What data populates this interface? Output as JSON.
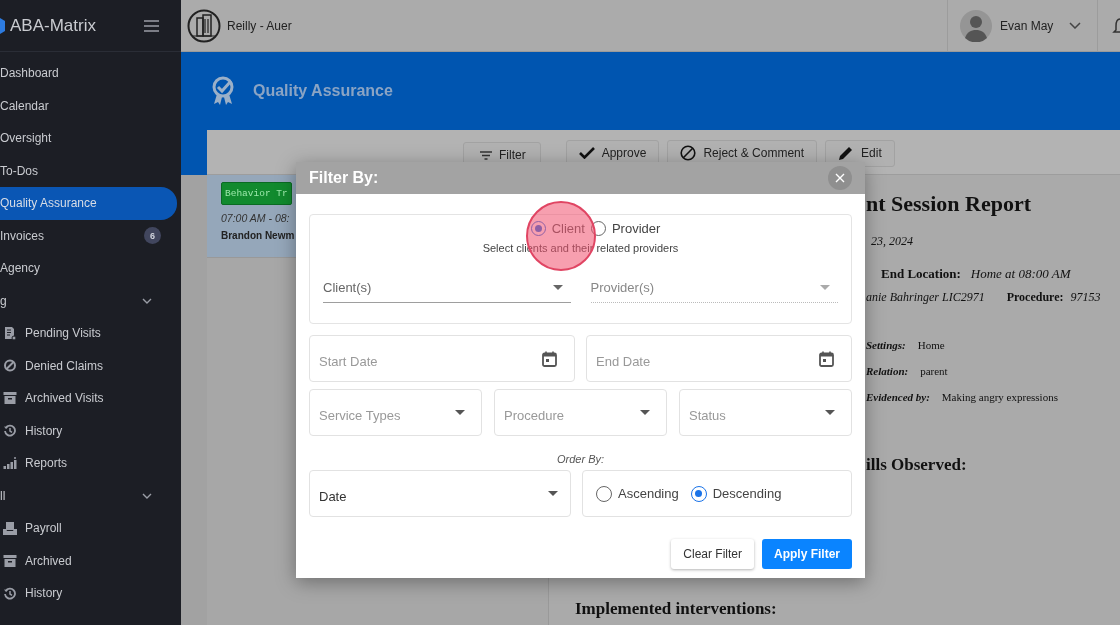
{
  "sidebar": {
    "brand": "ABA-Matrix",
    "items": [
      {
        "label": "Dashboard",
        "selected": false
      },
      {
        "label": "Calendar",
        "selected": false
      },
      {
        "label": "Oversight",
        "selected": false
      },
      {
        "label": "To-Dos",
        "selected": false
      },
      {
        "label": "Quality Assurance",
        "selected": true
      },
      {
        "label": "Invoices",
        "selected": false,
        "badge": "6"
      },
      {
        "label": "Agency",
        "selected": false
      }
    ],
    "sections": [
      {
        "title": "g",
        "expanded": true,
        "items": [
          {
            "label": "Pending Visits"
          },
          {
            "label": "Denied Claims"
          },
          {
            "label": "Archived Visits"
          },
          {
            "label": "History"
          },
          {
            "label": "Reports"
          }
        ]
      },
      {
        "title": "ll",
        "expanded": true,
        "items": [
          {
            "label": "Payroll"
          },
          {
            "label": "Archived"
          },
          {
            "label": "History"
          }
        ]
      }
    ]
  },
  "topbar": {
    "organization": "Reilly - Auer",
    "user": "Evan May"
  },
  "page_header": {
    "title": "Quality Assurance"
  },
  "toolbar": {
    "buttons": [
      "Filter",
      "Approve",
      "Reject & Comment",
      "Edit"
    ]
  },
  "visits": [
    {
      "tag": "Behavior Tr",
      "time": "07:00 AM - 08:",
      "client": "Brandon Newm",
      "selected": true
    }
  ],
  "report": {
    "title": "nt Session Report",
    "date": "23, 2024",
    "end_location_label": "End Location:",
    "end_location": "Home at 08:00 AM",
    "provider": "anie Bahringer LIC2971",
    "procedure_label": "Procedure:",
    "procedure": "97153",
    "details": [
      {
        "label": "Settings:",
        "value": "Home"
      },
      {
        "label": "Relation:",
        "value": "parent"
      },
      {
        "label": "Evidenced by:",
        "value": "Making angry expressions"
      }
    ],
    "skills_heading": "ills Observed:",
    "interventions_heading": "Implemented interventions:"
  },
  "modal": {
    "title": "Filter By:",
    "target_radios": [
      {
        "label": "Client",
        "selected": true
      },
      {
        "label": "Provider",
        "selected": false
      }
    ],
    "hint": "Select clients and their related providers",
    "client_select": {
      "placeholder": "Client(s)",
      "disabled": false
    },
    "provider_select": {
      "placeholder": "Provider(s)",
      "disabled": true
    },
    "start_date": {
      "placeholder": "Start Date"
    },
    "end_date": {
      "placeholder": "End Date"
    },
    "selects": [
      {
        "placeholder": "Service Types"
      },
      {
        "placeholder": "Procedure"
      },
      {
        "placeholder": "Status"
      }
    ],
    "order_by_label": "Order By:",
    "order_field": {
      "value": "Date"
    },
    "order_radios": [
      {
        "label": "Ascending",
        "selected": false
      },
      {
        "label": "Descending",
        "selected": true
      }
    ],
    "buttons": [
      {
        "label": "Clear Filter",
        "kind": "secondary"
      },
      {
        "label": "Apply Filter",
        "kind": "primary"
      }
    ]
  },
  "click_marker": true
}
